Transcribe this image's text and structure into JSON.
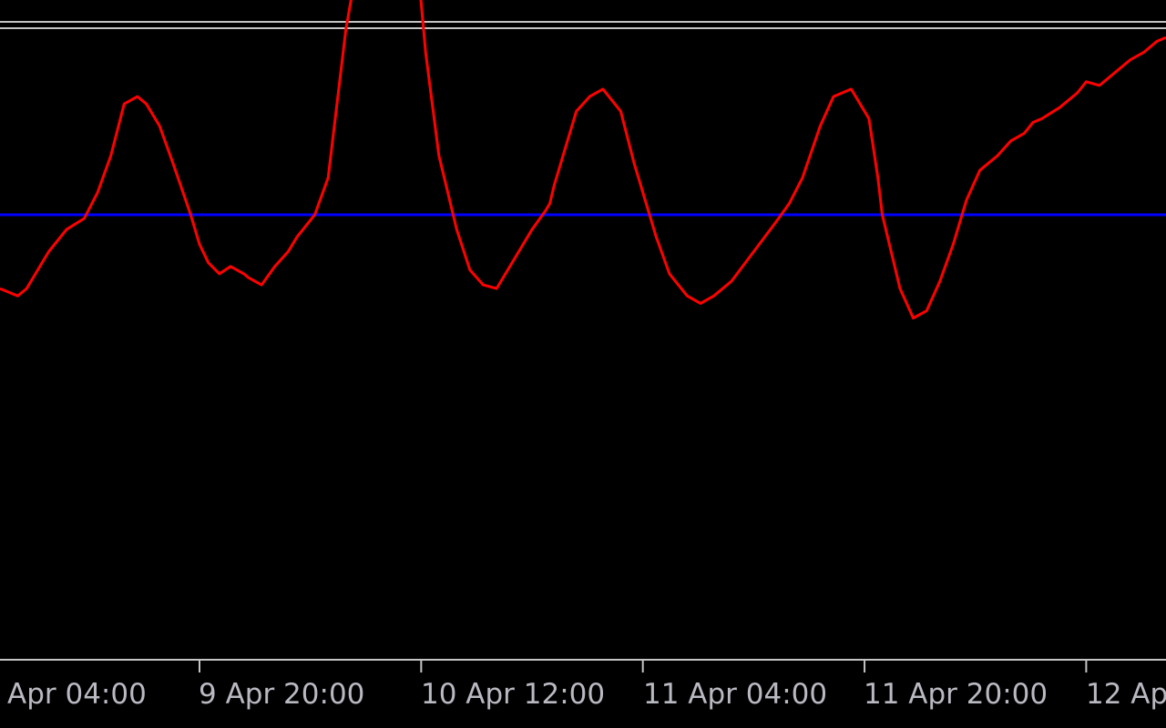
{
  "chart_data": {
    "type": "line",
    "title": "",
    "xlabel": "",
    "ylabel": "",
    "grid": false,
    "x_ticks": [
      "Apr 04:00",
      "9 Apr 20:00",
      "10 Apr 12:00",
      "11 Apr 04:00",
      "11 Apr 20:00",
      "12 Ap"
    ],
    "x_tick_bars": [
      0.9,
      1.9,
      2.9,
      3.9,
      4.9
    ],
    "ylim": [
      -60,
      25
    ],
    "reference_level": 0,
    "xlim": [
      0.0,
      5.26
    ],
    "series": [
      {
        "color": "#ff0000",
        "x": [
          0.0,
          0.08,
          0.12,
          0.16,
          0.22,
          0.3,
          0.38,
          0.44,
          0.5,
          0.56,
          0.62,
          0.66,
          0.72,
          0.78,
          0.86,
          0.9,
          0.94,
          0.99,
          1.04,
          1.1,
          1.12,
          1.18,
          1.24,
          1.3,
          1.34,
          1.42,
          1.48,
          1.56,
          1.6,
          1.66,
          1.72,
          1.78,
          1.86,
          1.92,
          1.98,
          2.02,
          2.06,
          2.12,
          2.18,
          2.24,
          2.32,
          2.4,
          2.46,
          2.48,
          2.5,
          2.55,
          2.6,
          2.66,
          2.72,
          2.8,
          2.86,
          2.96,
          3.02,
          3.1,
          3.16,
          3.22,
          3.3,
          3.4,
          3.5,
          3.56,
          3.62,
          3.7,
          3.76,
          3.84,
          3.92,
          3.96,
          3.98,
          4.06,
          4.12,
          4.18,
          4.24,
          4.3,
          4.36,
          4.42,
          4.5,
          4.56,
          4.62,
          4.66,
          4.7,
          4.78,
          4.86,
          4.9,
          4.96,
          5.02,
          5.08,
          5.1,
          5.16,
          5.22,
          5.26
        ],
        "y": [
          -10.0,
          -11.0,
          -10.0,
          -8.0,
          -5.0,
          -2.0,
          -0.5,
          3.0,
          8.0,
          15.0,
          16.0,
          15.0,
          12.0,
          7.0,
          0.0,
          -4.0,
          -6.5,
          -8.0,
          -7.0,
          -8.0,
          -8.5,
          -9.5,
          -7.0,
          -5.0,
          -3.0,
          0.0,
          5.0,
          25.0,
          32.0,
          38.0,
          42.0,
          44.0,
          42.0,
          22.0,
          8.0,
          3.0,
          -2.0,
          -7.5,
          -9.5,
          -10.0,
          -6.0,
          -2.0,
          0.5,
          1.5,
          4.0,
          9.0,
          14.0,
          16.0,
          17.0,
          14.0,
          7.0,
          -3.0,
          -8.0,
          -11.0,
          -12.0,
          -11.0,
          -9.0,
          -5.0,
          -1.0,
          1.5,
          5.0,
          12.0,
          16.0,
          17.0,
          13.0,
          5.0,
          0.0,
          -10.0,
          -14.0,
          -13.0,
          -9.0,
          -4.0,
          2.0,
          6.0,
          8.0,
          10.0,
          11.0,
          12.5,
          13.0,
          14.5,
          16.5,
          18.0,
          17.5,
          19.0,
          20.5,
          21.0,
          22.0,
          23.5,
          24.0
        ]
      }
    ]
  }
}
